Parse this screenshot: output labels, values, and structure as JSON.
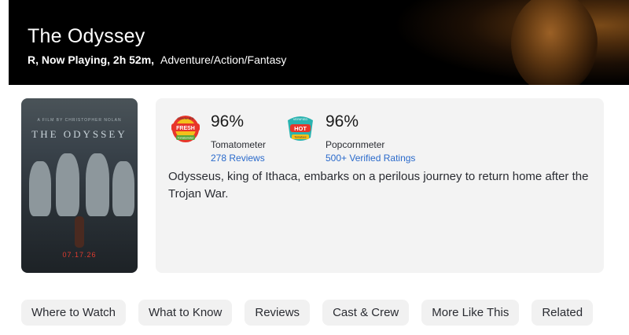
{
  "movie": {
    "title": "The Odyssey",
    "rating_status_runtime": "R, Now Playing, 2h 52m,",
    "genres": "Adventure/Action/Fantasy",
    "synopsis": "Odysseus, king of Ithaca, embarks on a perilous journey to return home after the Trojan War."
  },
  "poster": {
    "credit": "A FILM BY CHRISTOPHER NOLAN",
    "title": "THE ODYSSEY",
    "date": "07.17.26"
  },
  "tomatometer": {
    "badge_top": "CERTIFIED",
    "badge_main": "FRESH",
    "badge_sub": "Tomatometer",
    "percent": "96%",
    "label": "Tomatometer",
    "link": "278 Reviews"
  },
  "popcornmeter": {
    "badge_top": "VERIFIED",
    "badge_main": "HOT",
    "badge_sub": "Tomatoes",
    "percent": "96%",
    "label": "Popcornmeter",
    "link": "500+ Verified Ratings"
  },
  "nav": {
    "items": [
      {
        "label": "Where to Watch"
      },
      {
        "label": "What to Know"
      },
      {
        "label": "Reviews"
      },
      {
        "label": "Cast & Crew"
      },
      {
        "label": "More Like This"
      },
      {
        "label": "Related"
      }
    ]
  },
  "colors": {
    "hero_bg": "#000000",
    "link": "#2a6acb",
    "panel_bg": "#f3f3f3",
    "pill_bg": "#f1f1f1",
    "fresh_red": "#e8352a",
    "fresh_yellow": "#f3c01b",
    "hot_teal": "#2ab3b0"
  }
}
